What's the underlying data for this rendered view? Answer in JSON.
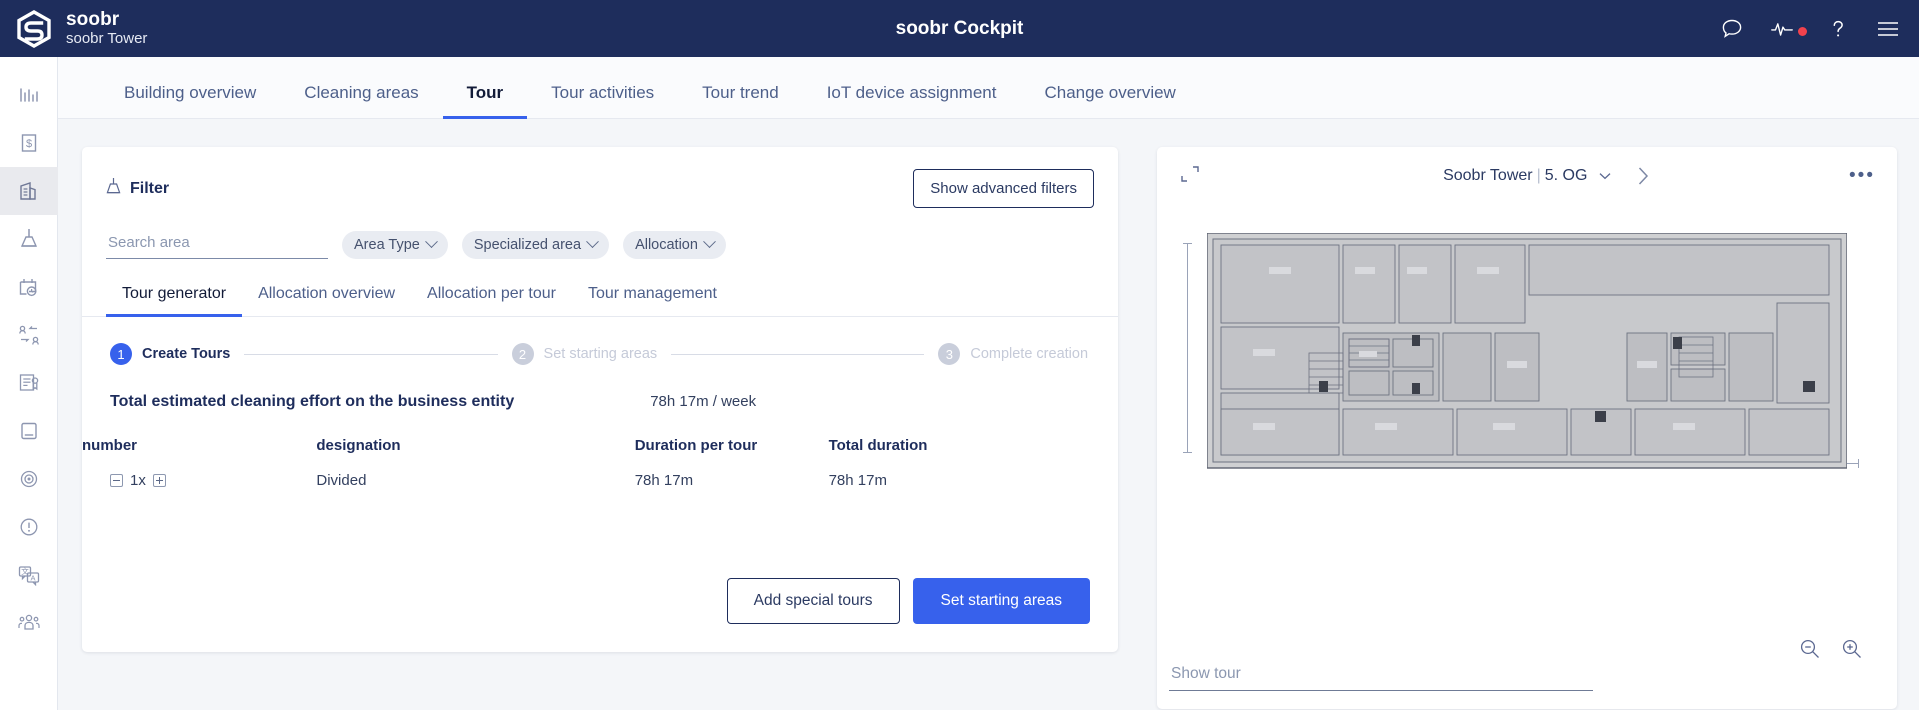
{
  "topbar": {
    "brand_name": "soobr",
    "brand_sub": "soobr Tower",
    "app_title": "soobr Cockpit",
    "icons": [
      {
        "name": "chat-icon",
        "label": "Chat"
      },
      {
        "name": "activity-icon",
        "label": "Activity"
      },
      {
        "name": "help-icon",
        "label": "Help"
      },
      {
        "name": "menu-icon",
        "label": "Menu"
      }
    ]
  },
  "rail": {
    "items": [
      {
        "name": "statistics-icon",
        "label": "Statistics",
        "active": false
      },
      {
        "name": "billing-icon",
        "label": "Billing",
        "active": false
      },
      {
        "name": "building-icon",
        "label": "Buildings",
        "active": true
      },
      {
        "name": "cleaning-icon",
        "label": "Cleaning",
        "active": false
      },
      {
        "name": "schedule-icon",
        "label": "Schedule",
        "active": false
      },
      {
        "name": "user-exchange-icon",
        "label": "User exchange",
        "active": false
      },
      {
        "name": "report-icon",
        "label": "Reports",
        "active": false
      },
      {
        "name": "device-icon",
        "label": "Devices",
        "active": false
      },
      {
        "name": "sensor-icon",
        "label": "Sensors",
        "active": false
      },
      {
        "name": "alert-icon",
        "label": "Alerts",
        "active": false
      },
      {
        "name": "translate-icon",
        "label": "Translations",
        "active": false
      },
      {
        "name": "team-icon",
        "label": "Team",
        "active": false
      }
    ]
  },
  "nav": {
    "tabs": [
      {
        "label": "Building overview",
        "active": false
      },
      {
        "label": "Cleaning areas",
        "active": false
      },
      {
        "label": "Tour",
        "active": true
      },
      {
        "label": "Tour activities",
        "active": false
      },
      {
        "label": "Tour trend",
        "active": false
      },
      {
        "label": "IoT device assignment",
        "active": false
      },
      {
        "label": "Change overview",
        "active": false
      }
    ]
  },
  "filter": {
    "title": "Filter",
    "advanced_button": "Show advanced filters",
    "search_placeholder": "Search area",
    "search_value": "",
    "chips": [
      {
        "label": "Area Type"
      },
      {
        "label": "Specialized area"
      },
      {
        "label": "Allocation"
      }
    ]
  },
  "subtabs": [
    {
      "label": "Tour generator",
      "active": true
    },
    {
      "label": "Allocation overview",
      "active": false
    },
    {
      "label": "Allocation per tour",
      "active": false
    },
    {
      "label": "Tour management",
      "active": false
    }
  ],
  "stepper": [
    {
      "number": "1",
      "label": "Create Tours",
      "active": true
    },
    {
      "number": "2",
      "label": "Set starting areas",
      "active": false
    },
    {
      "number": "3",
      "label": "Complete creation",
      "active": false
    }
  ],
  "summary": {
    "title": "Total estimated cleaning effort on the business entity",
    "value": "78h 17m / week"
  },
  "table": {
    "headers": [
      "number",
      "designation",
      "Duration per tour",
      "Total duration"
    ],
    "rows": [
      {
        "number": "1x",
        "designation": "Divided",
        "duration_per_tour": "78h 17m",
        "total_duration": "78h 17m"
      }
    ]
  },
  "actions": {
    "secondary": "Add special tours",
    "primary": "Set starting areas"
  },
  "floorplan": {
    "expand_icon": "expand-icon",
    "building": "Soobr Tower",
    "floor": "5. OG",
    "next_icon": "chevron-right-icon",
    "more_icon": "more-options-icon",
    "show_tour_placeholder": "Show tour",
    "zoom_out_icon": "zoom-out-icon",
    "zoom_in_icon": "zoom-in-icon"
  },
  "colors": {
    "header_navy": "#1e2d5c",
    "accent_blue": "#3761ec",
    "alert_red": "#f2424d",
    "page_bg": "#f4f6f9",
    "chip_bg": "#e9ecf2"
  }
}
